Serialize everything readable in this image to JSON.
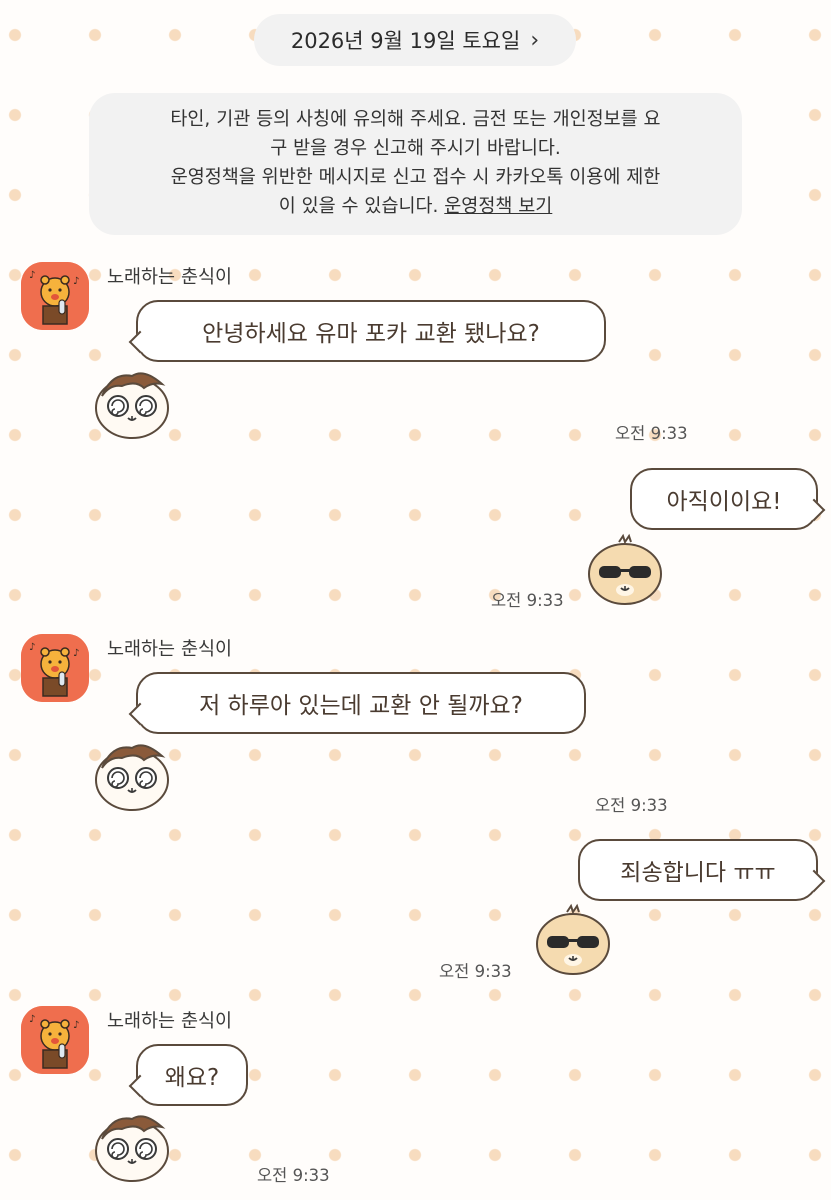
{
  "date_header": {
    "label": "2026년 9월 19일 토요일",
    "chevron": "chevron-right-icon"
  },
  "notice": {
    "line1": "타인, 기관 등의 사칭에 유의해 주세요. 금전 또는 개인정보를 요",
    "line2": "구 받을 경우 신고해 주시기 바랍니다.",
    "line3": "운영정책을 위반한 메시지로 신고 접수 시 카카오톡 이용에 제한",
    "line4_prefix": "이 있을 수 있습니다. ",
    "link": "운영정책 보기"
  },
  "messages": [
    {
      "sender": "노래하는 춘식이",
      "text": "안녕하세요 유마 포카 교환 됐나요?",
      "time": "오전 9:33",
      "side": "left"
    },
    {
      "text": "아직이이요!",
      "time": "오전 9:33",
      "side": "right"
    },
    {
      "sender": "노래하는 춘식이",
      "text": "저 하루아 있는데 교환 안 될까요?",
      "time": "오전 9:33",
      "side": "left"
    },
    {
      "text": "죄송합니다 ㅠㅠ",
      "time": "오전 9:33",
      "side": "right"
    },
    {
      "sender": "노래하는 춘식이",
      "text": "왜요?",
      "time": "오전 9:33",
      "side": "left"
    }
  ],
  "colors": {
    "avatar_bg": "#ef6e4e",
    "bubble_border": "#5a4a3c",
    "dot": "#f7dcbf",
    "pill_bg": "#f2f2f2"
  }
}
